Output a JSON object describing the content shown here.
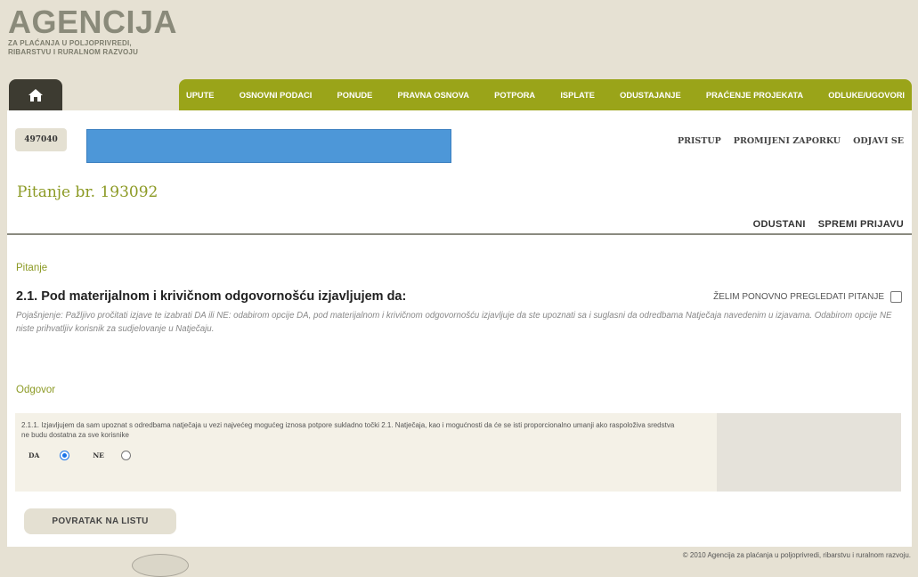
{
  "header": {
    "logo_title": "AGENCIJA",
    "logo_sub1": "ZA PLAĆANJA U POLJOPRIVREDI,",
    "logo_sub2": "RIBARSTVU I RURALNOM RAZVOJU"
  },
  "nav": {
    "home_icon": "home-icon",
    "items": [
      "UPUTE",
      "OSNOVNI PODACI",
      "PONUDE",
      "PRAVNA OSNOVA",
      "POTPORA",
      "ISPLATE",
      "ODUSTAJANJE",
      "PRAĆENJE PROJEKATA",
      "ODLUKE/UGOVORI"
    ]
  },
  "user": {
    "id": "497040",
    "links": [
      "PRISTUP",
      "PROMIJENI ZAPORKU",
      "ODJAVI SE"
    ]
  },
  "page": {
    "title": "Pitanje br. 193092",
    "actions": [
      "ODUSTANI",
      "SPREMI PRIJAVU"
    ]
  },
  "question": {
    "section_label": "Pitanje",
    "title": "2.1. Pod materijalnom i krivičnom odgovornošću izjavljujem da:",
    "review_label": "ŽELIM PONOVNO PREGLEDATI PITANJE",
    "review_checked": false,
    "explanation": "Pojašnjenje: Pažljivo pročitati izjave te izabrati DA ili NE: odabirom opcije DA, pod materijalnom i krivičnom odgovornošću izjavljuje da ste upoznati sa i suglasni da odredbama Natječaja navedenim u izjavama. Odabirom opcije NE niste prihvatljiv korisnik za sudjelovanje u Natječaju."
  },
  "answer": {
    "section_label": "Odgovor",
    "statement": "2.1.1. Izjavljujem da sam upoznat s odredbama natječaja u vezi najvećeg mogućeg iznosa potpore sukladno točki 2.1. Natječaja, kao i mogućnosti da će se isti proporcionalno umanji ako raspoloživa sredstva ne budu dostatna za sve korisnike",
    "option_yes": "DA",
    "option_no": "NE",
    "selected": "DA"
  },
  "back_button": "POVRATAK NA LISTU",
  "footer": "© 2010 Agencija za plaćanja u poljoprivredi, ribarstvu i ruralnom razvoju.",
  "colors": {
    "nav_green": "#9aa419",
    "accent_text": "#8c9a24",
    "page_bg": "#e6e1d3",
    "redaction_blue": "#4d97d8"
  }
}
